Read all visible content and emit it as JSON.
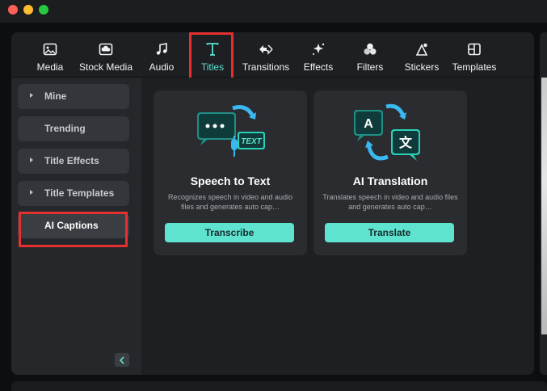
{
  "toolbar": {
    "tabs": [
      {
        "label": "Media",
        "icon": "media-icon"
      },
      {
        "label": "Stock Media",
        "icon": "stock-media-icon"
      },
      {
        "label": "Audio",
        "icon": "music-note-icon"
      },
      {
        "label": "Titles",
        "icon": "text-t-icon",
        "active": true
      },
      {
        "label": "Transitions",
        "icon": "transitions-icon"
      },
      {
        "label": "Effects",
        "icon": "sparkle-icon"
      },
      {
        "label": "Filters",
        "icon": "filters-icon"
      },
      {
        "label": "Stickers",
        "icon": "stickers-icon"
      },
      {
        "label": "Templates",
        "icon": "templates-icon"
      }
    ]
  },
  "sidebar": {
    "items": [
      {
        "label": "Mine",
        "caret": true
      },
      {
        "label": "Trending",
        "caret": false
      },
      {
        "label": "Title Effects",
        "caret": true
      },
      {
        "label": "Title Templates",
        "caret": true
      },
      {
        "label": "AI Captions",
        "caret": false,
        "active": true
      }
    ]
  },
  "cards": [
    {
      "title": "Speech to Text",
      "description": "Recognizes speech in video and audio files and generates auto cap…",
      "button": "Transcribe",
      "art_label": "TEXT"
    },
    {
      "title": "AI Translation",
      "description": "Translates speech in video and audio files and generates auto cap…",
      "button": "Translate",
      "art_label_a": "A",
      "art_label_b": "文"
    }
  ],
  "colors": {
    "accent": "#5fe0cf",
    "highlight_box": "#e63030"
  }
}
